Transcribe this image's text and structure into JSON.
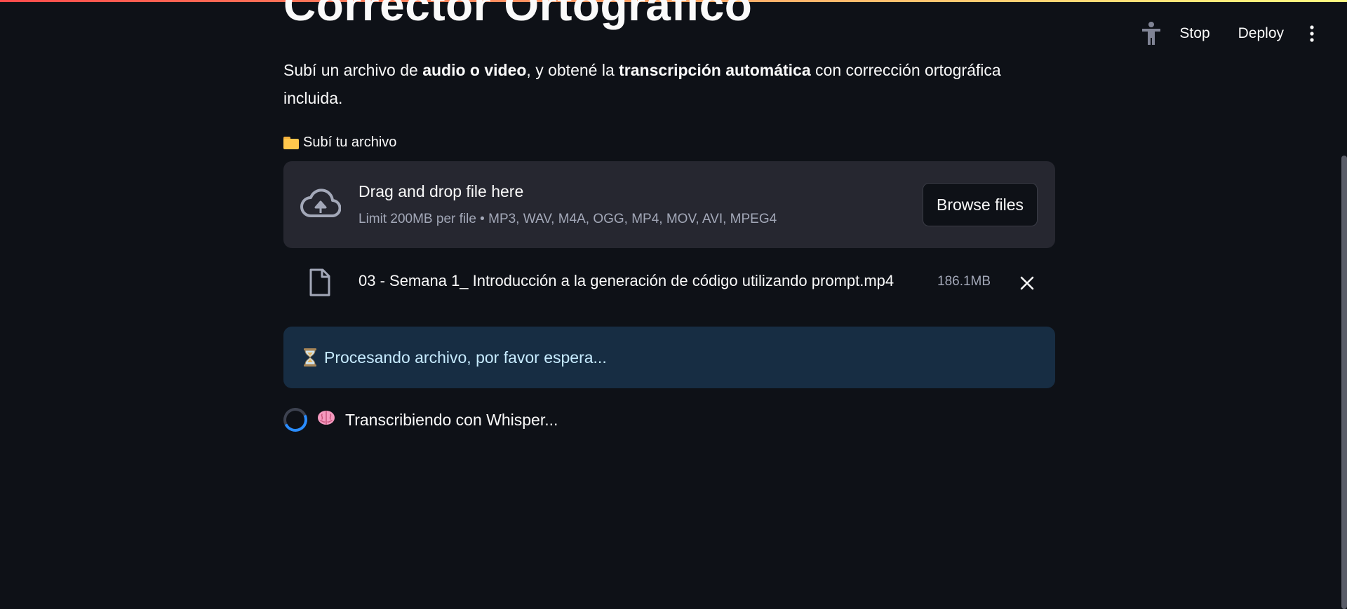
{
  "toolbar": {
    "stop_label": "Stop",
    "deploy_label": "Deploy"
  },
  "page": {
    "title": "Corrector Ortográfico",
    "intro": {
      "part1": "Subí un archivo de ",
      "bold1": "audio o video",
      "part2": ", y obtené la ",
      "bold2": "transcripción automática",
      "part3": " con corrección ortográfica incluida."
    }
  },
  "uploader": {
    "label": "Subí tu archivo",
    "drop_title": "Drag and drop file here",
    "drop_subtitle": "Limit 200MB per file • MP3, WAV, M4A, OGG, MP4, MOV, AVI, MPEG4",
    "browse_label": "Browse files",
    "file": {
      "name": "03 - Semana 1_ Introducción a la generación de código utilizando prompt.mp4",
      "size": "186.1MB"
    }
  },
  "status": {
    "info": "Procesando archivo, por favor espera...",
    "spinner_text": "Transcribiendo con Whisper..."
  },
  "colors": {
    "background": "#0e1117",
    "dropzone": "#262730",
    "info_bg": "#172d43",
    "info_text": "#c7ebff",
    "accent": "#2a8cff"
  }
}
